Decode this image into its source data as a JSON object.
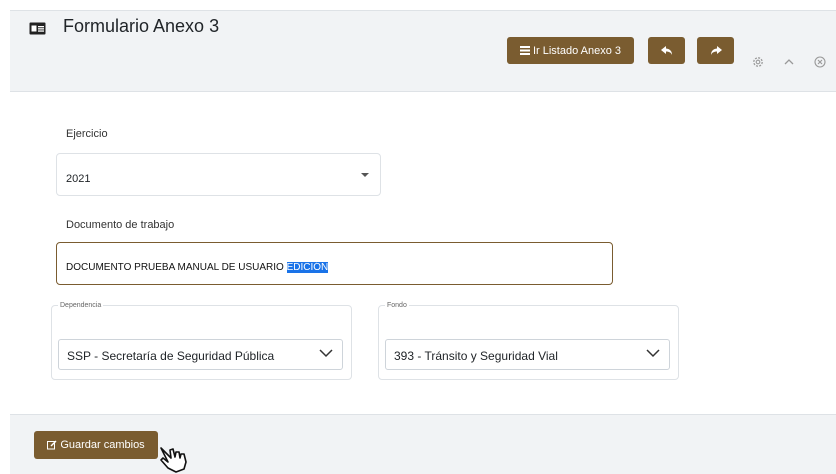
{
  "header": {
    "title": "Formulario Anexo 3",
    "title_icon": "id-card-icon",
    "buttons": {
      "list_label": "Ir Listado Anexo 3",
      "list_icon": "list-icon",
      "undo_icon": "undo-icon",
      "redo_icon": "redo-icon"
    },
    "tools": [
      "gear-icon",
      "chevron-up-icon",
      "close-circle-icon"
    ]
  },
  "form": {
    "ejercicio": {
      "label": "Ejercicio",
      "value": "2021"
    },
    "documento": {
      "label": "Documento de trabajo",
      "value_plain": "DOCUMENTO PRUEBA MANUAL DE USUARIO ",
      "value_selected": "EDICIÓN"
    },
    "dependencia": {
      "legend": "Dependencia",
      "value": "SSP - Secretaría de Seguridad Pública"
    },
    "fondo": {
      "legend": "Fondo",
      "value": "393 - Tránsito y Seguridad Vial"
    }
  },
  "footer": {
    "save_label": "Guardar cambios",
    "save_icon": "edit-icon"
  },
  "colors": {
    "accent": "#7a5c30",
    "panel": "#f1f3f5",
    "selection": "#1a73e8"
  }
}
